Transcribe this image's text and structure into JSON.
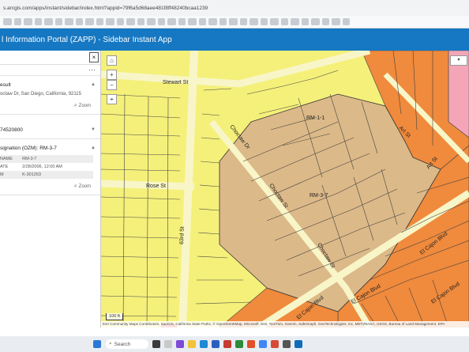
{
  "browser": {
    "url": "s.arcgis.com/apps/instant/sidebar/index.html?appid=79f6a5d68aee481f8ff48240bcaa1239"
  },
  "app": {
    "title": "l Information Portal (ZAPP) - Sidebar Instant App",
    "header_color": "#1678c2"
  },
  "sidebar": {
    "close_label": "×",
    "more_label": "⋯",
    "search_result": {
      "heading": "esult",
      "address": "octaw Dr, San Diego, California, 92115",
      "zoom_label": "Zoom"
    },
    "parcel": {
      "heading": "74520800"
    },
    "zone": {
      "heading": "signation (OZM): RM-3-7",
      "attributes": [
        {
          "key": "NAME",
          "value": "RM-3-7"
        },
        {
          "key": "ATE",
          "value": "2/28/2006, 12:00 AM"
        },
        {
          "key": "M",
          "value": "K-301263"
        }
      ],
      "zoom_label": "Zoom"
    }
  },
  "map": {
    "streets": [
      "Stewart St",
      "Rose St",
      "63rd St",
      "Choctaw Dr",
      "Choctaw St",
      "Choctaw St",
      "Art St",
      "Art St",
      "El Cajon Blvd",
      "El Cajon Blvd",
      "El Cajon Blvd",
      "El Cajon Blvd"
    ],
    "zones": [
      "RM-1-1",
      "RM-3-7"
    ],
    "controls": {
      "home": "⌂",
      "zoom_in": "+",
      "zoom_out": "−",
      "locate": "⌖",
      "layers": "▾"
    },
    "scale_label": "100 ft",
    "attribution": "Esri Community Maps Contributors, SanGIS, California State Parks, © OpenStreetMap, Microsoft, Esri, TomTom, Garmin, SafeGraph, GeoTechnologies, Inc, METI/NASA, USGS, Bureau of Land Management, EPA",
    "colors": {
      "yellow": "#f5f07a",
      "tan": "#d9b28a",
      "orange": "#f08a3c",
      "pink": "#f4a6b8",
      "red": "#e8413a"
    }
  },
  "taskbar": {
    "search_label": "Search"
  }
}
